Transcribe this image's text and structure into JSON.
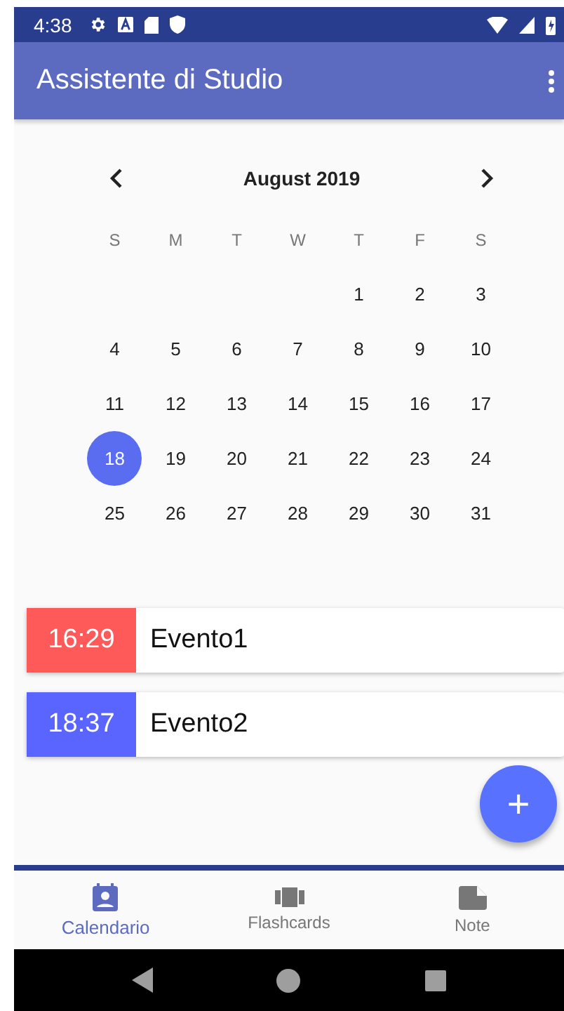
{
  "status_bar": {
    "time": "4:38"
  },
  "app_bar": {
    "title": "Assistente di Studio"
  },
  "calendar": {
    "month": "August 2019",
    "weekdays": [
      "S",
      "M",
      "T",
      "W",
      "T",
      "F",
      "S"
    ],
    "weeks": [
      [
        {
          "day": "1",
          "selected": false
        },
        {
          "day": "2",
          "selected": false
        },
        {
          "day": "3",
          "selected": false
        }
      ],
      [
        {
          "day": "4",
          "selected": false
        },
        {
          "day": "5",
          "selected": false
        },
        {
          "day": "6",
          "selected": false
        },
        {
          "day": "7",
          "selected": false
        },
        {
          "day": "8",
          "selected": false
        },
        {
          "day": "9",
          "selected": false
        },
        {
          "day": "10",
          "selected": false
        }
      ],
      [
        {
          "day": "11",
          "selected": false
        },
        {
          "day": "12",
          "selected": false
        },
        {
          "day": "13",
          "selected": false
        },
        {
          "day": "14",
          "selected": false
        },
        {
          "day": "15",
          "selected": false
        },
        {
          "day": "16",
          "selected": false
        },
        {
          "day": "17",
          "selected": false
        }
      ],
      [
        {
          "day": "18",
          "selected": true
        },
        {
          "day": "19",
          "selected": false
        },
        {
          "day": "20",
          "selected": false
        },
        {
          "day": "21",
          "selected": false
        },
        {
          "day": "22",
          "selected": false
        },
        {
          "day": "23",
          "selected": false
        },
        {
          "day": "24",
          "selected": false
        }
      ],
      [
        {
          "day": "25",
          "selected": false
        },
        {
          "day": "26",
          "selected": false
        },
        {
          "day": "27",
          "selected": false
        },
        {
          "day": "28",
          "selected": false
        },
        {
          "day": "29",
          "selected": false
        },
        {
          "day": "30",
          "selected": false
        },
        {
          "day": "31",
          "selected": false
        }
      ]
    ]
  },
  "events": [
    {
      "time": "16:29",
      "title": "Evento1",
      "color": "#ff5a5a"
    },
    {
      "time": "18:37",
      "title": "Evento2",
      "color": "#5a64ff"
    }
  ],
  "fab": {
    "label": "+"
  },
  "bottom_nav": [
    {
      "label": "Calendario",
      "kind": "calendar",
      "selected": true
    },
    {
      "label": "Flashcards",
      "kind": "cards",
      "selected": false
    },
    {
      "label": "Note",
      "kind": "note",
      "selected": false
    }
  ]
}
